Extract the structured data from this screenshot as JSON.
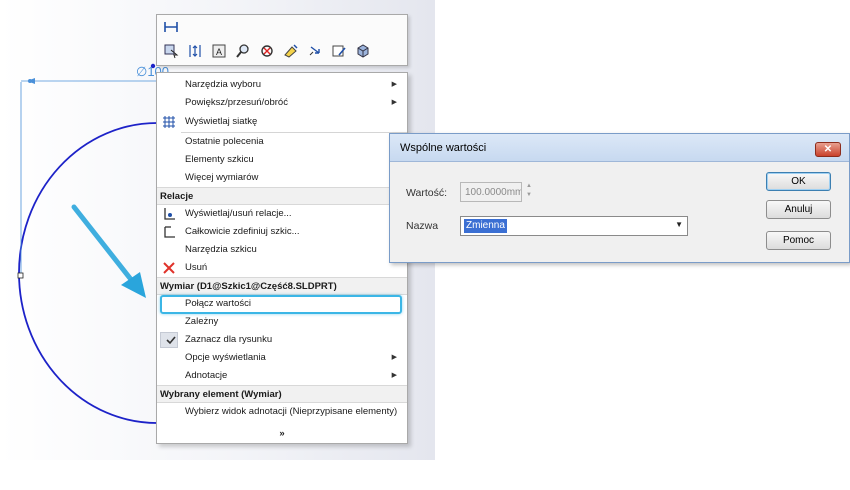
{
  "sketch": {
    "dimension_text": "∅100"
  },
  "colors": {
    "circle": "#1d22c8",
    "dimension": "#4a90d9",
    "highlight": "#3bb6e6",
    "arrow": "#2aa5dc",
    "delete_x": "#e0322a"
  },
  "toolbar": {
    "icons": [
      "smart-dimension-icon",
      "select-icon",
      "align-icon",
      "note-icon",
      "zoom-icon",
      "tools-icon",
      "sketch-icon",
      "undo-icon",
      "check-icon",
      "view-icon"
    ]
  },
  "menu": {
    "items": {
      "selection_tools": "Narzędzia wyboru",
      "zoom_pan": "Powiększ/przesuń/obróć",
      "show_grid": "Wyświetlaj siatkę",
      "recent_commands": "Ostatnie polecenia",
      "sketch_entities": "Elementy szkicu",
      "more_dimensions": "Więcej wymiarów",
      "relations_header": "Relacje",
      "show_relations": "Wyświetlaj/usuń relacje...",
      "fully_define": "Całkowicie zdefiniuj szkic...",
      "sketch_tools": "Narzędzia szkicu",
      "delete": "Usuń",
      "dimension_header": "Wymiar (D1@Szkic1@Część8.SLDPRT)",
      "link_values": "Połącz wartości",
      "driven": "Zależny",
      "mark_for_drawing": "Zaznacz dla rysunku",
      "display_options": "Opcje wyświetlania",
      "annotations": "Adnotacje",
      "selected_header": "Wybrany element (Wymiar)",
      "select_annotation_view": "Wybierz widok adnotacji (Nieprzypisane elementy)",
      "expand": "»"
    }
  },
  "dialog": {
    "title": "Wspólne wartości",
    "close": "✕",
    "value_label": "Wartość:",
    "value": "100.0000mm",
    "name_label": "Nazwa",
    "name_value": "Zmienna",
    "ok": "OK",
    "cancel": "Anuluj",
    "help": "Pomoc"
  }
}
